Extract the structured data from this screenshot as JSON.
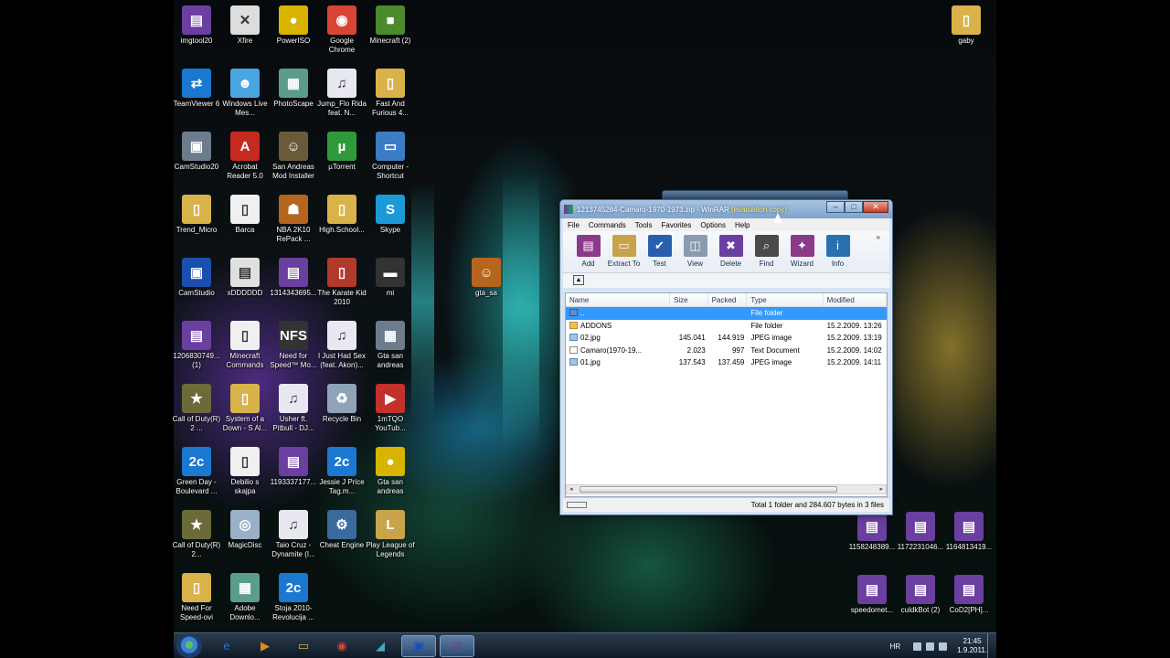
{
  "desktop_icons": [
    {
      "label": "imgtool20",
      "glyph": "▤",
      "color": "#6b3fa0"
    },
    {
      "label": "Xfire",
      "glyph": "✕",
      "color": "#dddddd"
    },
    {
      "label": "PowerISO",
      "glyph": "●",
      "color": "#d8b400"
    },
    {
      "label": "Google Chrome",
      "glyph": "◉",
      "color": "#d94535"
    },
    {
      "label": "Minecraft (2)",
      "glyph": "■",
      "color": "#4c8a2e"
    },
    {
      "label": "TeamViewer 6",
      "glyph": "⇄",
      "color": "#1a78d0"
    },
    {
      "label": "Windows Live Mes...",
      "glyph": "☻",
      "color": "#4aa6e0"
    },
    {
      "label": "PhotoScape",
      "glyph": "▦",
      "color": "#5c9c8c"
    },
    {
      "label": "Jump_Flo Rida feat. N...",
      "glyph": "♫",
      "color": "#e8e8f0"
    },
    {
      "label": "Fast And Furious 4...",
      "glyph": "▯",
      "color": "#d9b24a"
    },
    {
      "label": "CamStudio20",
      "glyph": "▣",
      "color": "#6d7b8c"
    },
    {
      "label": "Acrobat Reader 5.0",
      "glyph": "A",
      "color": "#c42a20"
    },
    {
      "label": "San Andreas Mod Installer",
      "glyph": "☺",
      "color": "#6b5a3a"
    },
    {
      "label": "µTorrent",
      "glyph": "µ",
      "color": "#2f9a3a"
    },
    {
      "label": "Computer - Shortcut",
      "glyph": "▭",
      "color": "#3b7cc4"
    },
    {
      "label": "Trend_Micro",
      "glyph": "▯",
      "color": "#d9b24a"
    },
    {
      "label": "Barca",
      "glyph": "▯",
      "color": "#f0f0f0"
    },
    {
      "label": "NBA 2K10 RePack ...",
      "glyph": "☗",
      "color": "#b5651d"
    },
    {
      "label": "High.School...",
      "glyph": "▯",
      "color": "#d9b24a"
    },
    {
      "label": "Skype",
      "glyph": "S",
      "color": "#1c9ad8"
    },
    {
      "label": "CamStudio",
      "glyph": "▣",
      "color": "#1a4fb0"
    },
    {
      "label": "xDDDDDD",
      "glyph": "▤",
      "color": "#e0e0e0"
    },
    {
      "label": "1314343695...",
      "glyph": "▤",
      "color": "#6b3fa0"
    },
    {
      "label": "The Karate Kid 2010",
      "glyph": "▯",
      "color": "#b23a2a"
    },
    {
      "label": "mi",
      "glyph": "▬",
      "color": "#333333"
    },
    {
      "label": "1206830749... (1)",
      "glyph": "▤",
      "color": "#6b3fa0"
    },
    {
      "label": "Minecraft Commands",
      "glyph": "▯",
      "color": "#f0f0f0"
    },
    {
      "label": "Need for Speed™ Mo...",
      "glyph": "NFS",
      "color": "#333333"
    },
    {
      "label": "I Just Had Sex (feat. Akon)...",
      "glyph": "♫",
      "color": "#e8e8f0"
    },
    {
      "label": "Gta san andreas",
      "glyph": "▦",
      "color": "#6d7b8c"
    },
    {
      "label": "Call of Duty(R) 2 ...",
      "glyph": "★",
      "color": "#6b6b3a"
    },
    {
      "label": "System of a Down - S Al...",
      "glyph": "▯",
      "color": "#d9b24a"
    },
    {
      "label": "Usher ft. Pitbull - DJ...",
      "glyph": "♫",
      "color": "#e8e8f0"
    },
    {
      "label": "Recycle Bin",
      "glyph": "♻",
      "color": "#8fa3b8"
    },
    {
      "label": "1mTQO YouTub...",
      "glyph": "▶",
      "color": "#c4302b"
    },
    {
      "label": "Green Day - Boulevard ...",
      "glyph": "2c",
      "color": "#1a78d0"
    },
    {
      "label": "Debilio s skajpa",
      "glyph": "▯",
      "color": "#f0f0f0"
    },
    {
      "label": "1193337177...",
      "glyph": "▤",
      "color": "#6b3fa0"
    },
    {
      "label": "Jessie J Price Tag.m...",
      "glyph": "2c",
      "color": "#1a78d0"
    },
    {
      "label": "Gta san andreas",
      "glyph": "●",
      "color": "#d8b400"
    },
    {
      "label": "Call of Duty(R) 2...",
      "glyph": "★",
      "color": "#6b6b3a"
    },
    {
      "label": "MagicDisc",
      "glyph": "◎",
      "color": "#9ab0c8"
    },
    {
      "label": "Taio Cruz - Dynamite (I...",
      "glyph": "♫",
      "color": "#e8e8f0"
    },
    {
      "label": "Cheat Engine",
      "glyph": "⚙",
      "color": "#3b6b9c"
    },
    {
      "label": "Play League of Legends",
      "glyph": "L",
      "color": "#c9a34a"
    },
    {
      "label": "Need For Speed-ovi",
      "glyph": "▯",
      "color": "#d9b24a"
    },
    {
      "label": "Adobe Downlo...",
      "glyph": "▦",
      "color": "#5c9c8c"
    },
    {
      "label": "Stoja 2010-Revolucija ...",
      "glyph": "2c",
      "color": "#1a78d0"
    }
  ],
  "extra_icons": {
    "gaby": {
      "label": "gaby",
      "glyph": "▯",
      "color": "#d9b24a"
    },
    "gta_sa": {
      "label": "gta_sa",
      "glyph": "☺",
      "color": "#b5651d"
    },
    "r1": {
      "label": "1158248389...",
      "glyph": "▤",
      "color": "#6b3fa0"
    },
    "r2": {
      "label": "1172231046...",
      "glyph": "▤",
      "color": "#6b3fa0"
    },
    "r3": {
      "label": "1164813419...",
      "glyph": "▤",
      "color": "#6b3fa0"
    },
    "r4": {
      "label": "speedomet...",
      "glyph": "▤",
      "color": "#6b3fa0"
    },
    "r5": {
      "label": "culdkBot (2)",
      "glyph": "▤",
      "color": "#6b3fa0"
    },
    "r6": {
      "label": "CoD2[PH]...",
      "glyph": "▤",
      "color": "#6b3fa0"
    }
  },
  "window": {
    "title": "1213745284-Camaro-1970-1973.zip - WinRAR",
    "title_eval": "(evaluation copy)",
    "controls": {
      "minimize": "–",
      "maximize": "□",
      "close": "✕"
    },
    "menu": [
      "File",
      "Commands",
      "Tools",
      "Favorites",
      "Options",
      "Help"
    ],
    "toolbar": [
      {
        "label": "Add",
        "glyph": "▤",
        "color": "#8b3a8a"
      },
      {
        "label": "Extract To",
        "glyph": "▭",
        "color": "#c9a34a"
      },
      {
        "label": "Test",
        "glyph": "✔",
        "color": "#2a5fb0"
      },
      {
        "label": "View",
        "glyph": "◫",
        "color": "#8a9ab0"
      },
      {
        "label": "Delete",
        "glyph": "✖",
        "color": "#6b3fa0"
      },
      {
        "label": "Find",
        "glyph": "⌕",
        "color": "#4a4a4a"
      },
      {
        "label": "Wizard",
        "glyph": "✦",
        "color": "#8b3a8a"
      },
      {
        "label": "Info",
        "glyph": "i",
        "color": "#2a6fb0"
      }
    ],
    "toolbar_more": "»",
    "columns": [
      "Name",
      "Size",
      "Packed",
      "Type",
      "Modified"
    ],
    "rows": [
      {
        "name": "..",
        "size": "",
        "packed": "",
        "type": "File folder",
        "modified": "",
        "icon": "up",
        "selected": true
      },
      {
        "name": "ADDONS",
        "size": "",
        "packed": "",
        "type": "File folder",
        "modified": "15.2.2009. 13:26",
        "icon": "folder",
        "selected": false
      },
      {
        "name": "02.jpg",
        "size": "145.041",
        "packed": "144.919",
        "type": "JPEG image",
        "modified": "15.2.2009. 13:19",
        "icon": "jpg",
        "selected": false
      },
      {
        "name": "Camaro(1970-19...",
        "size": "2.023",
        "packed": "997",
        "type": "Text Document",
        "modified": "15.2.2009. 14:02",
        "icon": "txt",
        "selected": false
      },
      {
        "name": "01.jpg",
        "size": "137.543",
        "packed": "137.459",
        "type": "JPEG image",
        "modified": "15.2.2009. 14:11",
        "icon": "jpg",
        "selected": false
      }
    ],
    "status": "Total 1 folder and 284.607 bytes in 3 files"
  },
  "taskbar": {
    "apps": [
      {
        "name": "ie",
        "glyph": "e",
        "color": "#1e78d2"
      },
      {
        "name": "media-player",
        "glyph": "▶",
        "color": "#e88a1a"
      },
      {
        "name": "explorer",
        "glyph": "▭",
        "color": "#d9b24a"
      },
      {
        "name": "chrome",
        "glyph": "◉",
        "color": "#d94535"
      },
      {
        "name": "app",
        "glyph": "◢",
        "color": "#4aa6c0"
      },
      {
        "name": "camstudio",
        "glyph": "▣",
        "color": "#1a4fb0"
      },
      {
        "name": "winrar",
        "glyph": "▤",
        "color": "#8b3a8a"
      }
    ],
    "lang": "HR",
    "time": "21:45",
    "date": "1.9.2011."
  }
}
